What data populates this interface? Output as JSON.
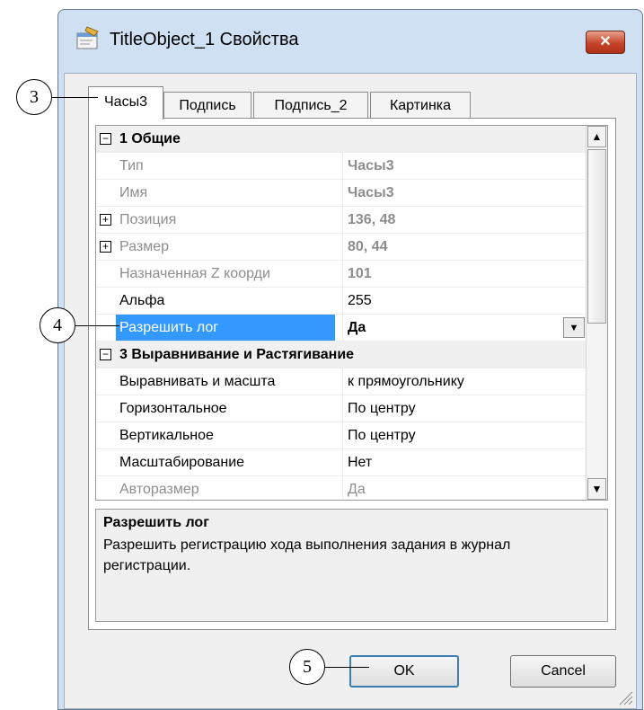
{
  "window": {
    "title": "TitleObject_1 Свойства",
    "close_label": "✕"
  },
  "tabs": [
    {
      "label": "Часы3",
      "active": true
    },
    {
      "label": "Подпись",
      "active": false
    },
    {
      "label": "Подпись_2",
      "active": false
    },
    {
      "label": "Картинка",
      "active": false
    }
  ],
  "grid": {
    "rows": [
      {
        "kind": "category",
        "expander": "−",
        "name": "1 Общие"
      },
      {
        "kind": "prop",
        "name": "Тип",
        "value": "Часы3",
        "name_dim": true,
        "value_dim": true,
        "value_bold": true
      },
      {
        "kind": "prop",
        "name": "Имя",
        "value": "Часы3",
        "name_dim": true,
        "value_dim": true,
        "value_bold": true
      },
      {
        "kind": "prop",
        "expander": "+",
        "name": "Позиция",
        "value": "136, 48",
        "name_dim": true,
        "value_dim": true,
        "value_bold": true
      },
      {
        "kind": "prop",
        "expander": "+",
        "name": "Размер",
        "value": "80, 44",
        "name_dim": true,
        "value_dim": true,
        "value_bold": true
      },
      {
        "kind": "prop",
        "name": "Назначенная Z коорди",
        "value": "101",
        "name_dim": true,
        "value_dim": true,
        "value_bold": true
      },
      {
        "kind": "prop",
        "name": "Альфа",
        "value": "255"
      },
      {
        "kind": "prop",
        "name": "Разрешить лог",
        "value": "Да",
        "selected": true,
        "value_bold": true,
        "dropdown": true
      },
      {
        "kind": "category",
        "expander": "−",
        "name": "3 Выравнивание и Растягивание"
      },
      {
        "kind": "prop",
        "name": "Выравнивать и масшта",
        "value": "к прямоугольнику"
      },
      {
        "kind": "prop",
        "name": "Горизонтальное",
        "value": "По центру"
      },
      {
        "kind": "prop",
        "name": "Вертикальное",
        "value": "По центру"
      },
      {
        "kind": "prop",
        "name": "Масштабирование",
        "value": "Нет"
      },
      {
        "kind": "prop",
        "name": "Авторазмер",
        "value": "Да",
        "name_dim": true,
        "value_dim": true
      }
    ],
    "dropdown_glyph": "▼",
    "scroll_up_glyph": "▲",
    "scroll_down_glyph": "▼"
  },
  "help": {
    "title": "Разрешить лог",
    "text": "Разрешить регистрацию хода выполнения задания в журнал регистрации."
  },
  "buttons": {
    "ok": "OK",
    "cancel": "Cancel"
  },
  "callouts": [
    "3",
    "4",
    "5"
  ],
  "colors": {
    "selection": "#3399ff",
    "close_button": "#c6442a",
    "default_button_border": "#3c7fb1"
  }
}
